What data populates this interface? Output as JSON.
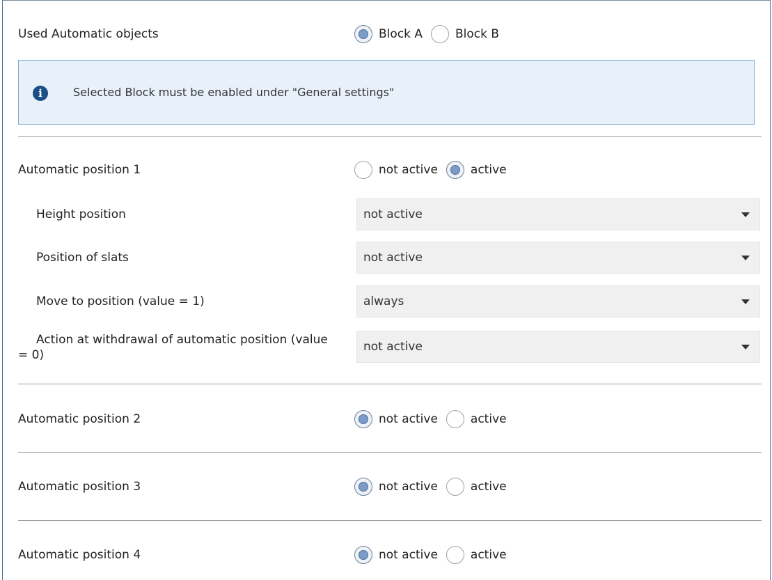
{
  "block_selector": {
    "label": "Used Automatic objects",
    "options": [
      "Block A",
      "Block B"
    ],
    "selected": 0
  },
  "info": {
    "icon": "info-icon",
    "glyph": "i",
    "text": "Selected Block must be enabled under \"General settings\""
  },
  "automatic_positions": [
    {
      "label": "Automatic position 1",
      "options": [
        "not active",
        "active"
      ],
      "selected": 1,
      "settings": [
        {
          "label": "Height position",
          "value": "not active"
        },
        {
          "label": "Position of slats",
          "value": "not active"
        },
        {
          "label": "Move to position (value = 1)",
          "value": "always"
        },
        {
          "label": "Action at withdrawal of automatic position (value = 0)",
          "value": "not active"
        }
      ]
    },
    {
      "label": "Automatic position 2",
      "options": [
        "not active",
        "active"
      ],
      "selected": 0
    },
    {
      "label": "Automatic position 3",
      "options": [
        "not active",
        "active"
      ],
      "selected": 0
    },
    {
      "label": "Automatic position 4",
      "options": [
        "not active",
        "active"
      ],
      "selected": 0
    }
  ]
}
